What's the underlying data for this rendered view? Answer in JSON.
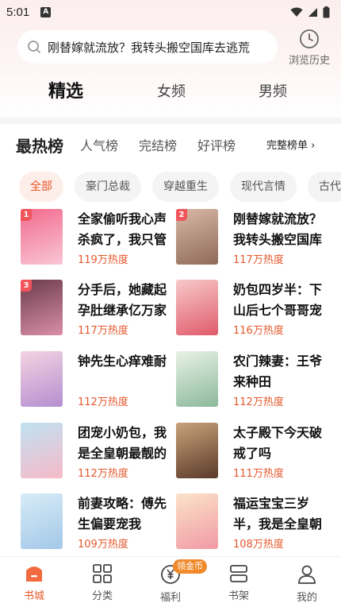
{
  "status_bar": {
    "time": "5:01",
    "notif_letter": "A"
  },
  "search": {
    "text": "刚替嫁就流放？我转头搬空国库去逃荒"
  },
  "history": {
    "label": "浏览历史"
  },
  "channel_tabs": [
    {
      "label": "精选",
      "active": true
    },
    {
      "label": "女频",
      "active": false
    },
    {
      "label": "男频",
      "active": false
    }
  ],
  "rank_tabs": [
    {
      "label": "最热榜",
      "active": true
    },
    {
      "label": "人气榜",
      "active": false
    },
    {
      "label": "完结榜",
      "active": false
    },
    {
      "label": "好评榜",
      "active": false
    }
  ],
  "full_rank_label": "完整榜单 ›",
  "chips": [
    {
      "label": "全部",
      "active": true
    },
    {
      "label": "豪门总裁",
      "active": false
    },
    {
      "label": "穿越重生",
      "active": false
    },
    {
      "label": "现代言情",
      "active": false
    },
    {
      "label": "古代",
      "active": false
    }
  ],
  "books": [
    {
      "rank": "1",
      "title": "全家偷听我心声杀疯了，我只管吃奶",
      "heat": "119万热度",
      "cover_colors": [
        "#f26a8d",
        "#f8c6d6"
      ]
    },
    {
      "rank": "2",
      "title": "刚替嫁就流放？我转头搬空国库去逃荒",
      "heat": "117万热度",
      "cover_colors": [
        "#d9b9a5",
        "#8e6a5a"
      ]
    },
    {
      "rank": "3",
      "title": "分手后，她藏起孕肚继承亿万家产",
      "heat": "117万热度",
      "cover_colors": [
        "#6b3b4c",
        "#d98fa6"
      ]
    },
    {
      "rank": "",
      "title": "奶包四岁半：下山后七个哥哥宠上天",
      "heat": "116万热度",
      "cover_colors": [
        "#f7c9c9",
        "#e05b6b"
      ]
    },
    {
      "rank": "",
      "title": "钟先生心痒难耐",
      "heat": "112万热度",
      "cover_colors": [
        "#f3d3e2",
        "#b58fd0"
      ]
    },
    {
      "rank": "",
      "title": "农门辣妻：王爷来种田",
      "heat": "112万热度",
      "cover_colors": [
        "#e8f2e6",
        "#8cb89b"
      ]
    },
    {
      "rank": "",
      "title": "团宠小奶包，我是全皇朝最靓的崽",
      "heat": "112万热度",
      "cover_colors": [
        "#bfe2f2",
        "#f7b9c8"
      ]
    },
    {
      "rank": "",
      "title": "太子殿下今天破戒了吗",
      "heat": "111万热度",
      "cover_colors": [
        "#c9a37a",
        "#5a3a2a"
      ]
    },
    {
      "rank": "",
      "title": "前妻攻略：傅先生偏要宠我",
      "heat": "109万热度",
      "cover_colors": [
        "#d7ecf7",
        "#a3c8e8"
      ]
    },
    {
      "rank": "",
      "title": "福运宝宝三岁半，我是全皇朝的团宠",
      "heat": "108万热度",
      "cover_colors": [
        "#fbe3c8",
        "#f19aa5"
      ]
    }
  ],
  "bottom_nav": [
    {
      "label": "书城",
      "icon": "bookstore-icon",
      "active": true
    },
    {
      "label": "分类",
      "icon": "category-icon",
      "active": false
    },
    {
      "label": "福利",
      "icon": "welfare-icon",
      "active": false
    },
    {
      "label": "书架",
      "icon": "bookshelf-icon",
      "active": false
    },
    {
      "label": "我的",
      "icon": "profile-icon",
      "active": false
    }
  ],
  "coin_badge": "领金币",
  "colors": {
    "accent": "#e8562a",
    "heat": "#e4582c"
  }
}
